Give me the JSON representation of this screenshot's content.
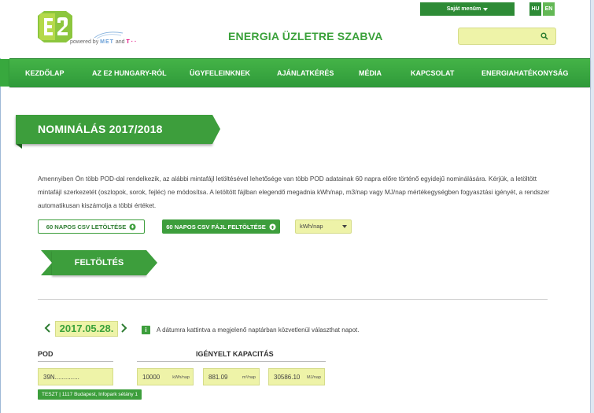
{
  "header": {
    "powered_prefix": "powered by",
    "powered_met": "MET",
    "powered_and": "and",
    "powered_telekom": "T · ·",
    "site_title": "ENERGIA ÜZLETRE SZABVA",
    "user_menu_label": "Saját menüm",
    "lang_hu": "HU",
    "lang_en": "EN",
    "search_value": "",
    "brand_color": "#3d9e3c"
  },
  "nav": {
    "items": [
      {
        "label": "KEZDŐLAP"
      },
      {
        "label": "AZ E2 HUNGARY-RÓL"
      },
      {
        "label": "ÜGYFELEINKNEK"
      },
      {
        "label": "AJÁNLATKÉRÉS"
      },
      {
        "label": "MÉDIA"
      },
      {
        "label": "KAPCSOLAT"
      },
      {
        "label": "ENERGIAHATÉKONYSÁG"
      }
    ]
  },
  "page": {
    "title": "NOMINÁLÁS 2017/2018",
    "intro": "Amennyiben Ön több POD-dal rendelkezik, az alábbi mintafájl letöltésével lehetősége van több POD adatainak 60 napra előre történő egyidejű nominálására. Kérjük, a letöltött mintafájl szerkezetét (oszlopok, sorok, fejléc) ne módosítsa. A letöltött fájlban elegendő megadnia kWh/nap, m3/nap vagy MJ/nap mértékegységben fogyasztási igényét, a rendszer automatikusan kiszámolja a többi értéket.",
    "download_csv_label": "60 NAPOS CSV LETÖLTÉSE",
    "upload_csv_label": "60 NAPOS CSV FÁJL FELTÖLTÉSE",
    "unit_selected": "kWh/nap",
    "upload_button_label": "FELTÖLTÉS",
    "date": "2017.05.28.",
    "date_hint": "A dátumra kattintva a megjelenő naptárban közvetlenül választhat napot.",
    "pod_label": "POD",
    "capacity_label": "IGÉNYELT KAPACITÁS",
    "pod_value": "39N..............",
    "kwh_value": "10000",
    "kwh_unit": "kWh/nap",
    "m3_value": "881.09",
    "m3_unit": "m³/nap",
    "mj_value": "30586.10",
    "mj_unit": "MJ/nap",
    "address": "TESZT | 1117 Budapest, Infopark sétány 1"
  }
}
